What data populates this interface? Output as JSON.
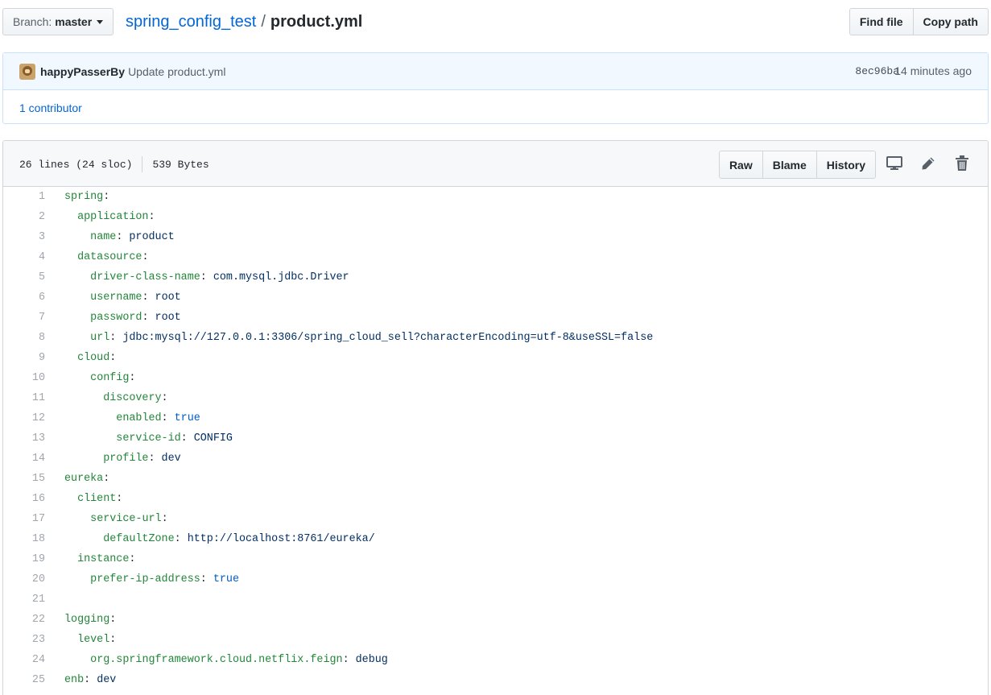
{
  "topbar": {
    "branch_prefix": "Branch:",
    "branch_name": "master",
    "repo": "spring_config_test",
    "sep": "/",
    "file": "product.yml",
    "find_file": "Find file",
    "copy_path": "Copy path"
  },
  "commit": {
    "author": "happyPasserBy",
    "message": "Update product.yml",
    "sha": "8ec96ba",
    "time": "14 minutes ago",
    "contributors": "1 contributor"
  },
  "file": {
    "lines_info": "26 lines (24 sloc)",
    "size": "539 Bytes",
    "raw": "Raw",
    "blame": "Blame",
    "history": "History",
    "icons": [
      "desktop-icon",
      "pencil-icon",
      "trash-icon"
    ]
  },
  "code": [
    {
      "n": "1",
      "indent": "",
      "key": "spring",
      "value": "",
      "vtype": ""
    },
    {
      "n": "2",
      "indent": "  ",
      "key": "application",
      "value": "",
      "vtype": ""
    },
    {
      "n": "3",
      "indent": "    ",
      "key": "name",
      "value": "product",
      "vtype": "str"
    },
    {
      "n": "4",
      "indent": "  ",
      "key": "datasource",
      "value": "",
      "vtype": ""
    },
    {
      "n": "5",
      "indent": "    ",
      "key": "driver-class-name",
      "value": "com.mysql.jdbc.Driver",
      "vtype": "str"
    },
    {
      "n": "6",
      "indent": "    ",
      "key": "username",
      "value": "root",
      "vtype": "str"
    },
    {
      "n": "7",
      "indent": "    ",
      "key": "password",
      "value": "root",
      "vtype": "str"
    },
    {
      "n": "8",
      "indent": "    ",
      "key": "url",
      "value": "jdbc:mysql://127.0.0.1:3306/spring_cloud_sell?characterEncoding=utf-8&useSSL=false",
      "vtype": "str"
    },
    {
      "n": "9",
      "indent": "  ",
      "key": "cloud",
      "value": "",
      "vtype": ""
    },
    {
      "n": "10",
      "indent": "    ",
      "key": "config",
      "value": "",
      "vtype": ""
    },
    {
      "n": "11",
      "indent": "      ",
      "key": "discovery",
      "value": "",
      "vtype": ""
    },
    {
      "n": "12",
      "indent": "        ",
      "key": "enabled",
      "value": "true",
      "vtype": "bool"
    },
    {
      "n": "13",
      "indent": "        ",
      "key": "service-id",
      "value": "CONFIG",
      "vtype": "str"
    },
    {
      "n": "14",
      "indent": "      ",
      "key": "profile",
      "value": "dev",
      "vtype": "str"
    },
    {
      "n": "15",
      "indent": "",
      "key": "eureka",
      "value": "",
      "vtype": ""
    },
    {
      "n": "16",
      "indent": "  ",
      "key": "client",
      "value": "",
      "vtype": ""
    },
    {
      "n": "17",
      "indent": "    ",
      "key": "service-url",
      "value": "",
      "vtype": ""
    },
    {
      "n": "18",
      "indent": "      ",
      "key": "defaultZone",
      "value": "http://localhost:8761/eureka/",
      "vtype": "str"
    },
    {
      "n": "19",
      "indent": "  ",
      "key": "instance",
      "value": "",
      "vtype": ""
    },
    {
      "n": "20",
      "indent": "    ",
      "key": "prefer-ip-address",
      "value": "true",
      "vtype": "bool"
    },
    {
      "n": "21",
      "indent": "",
      "key": "",
      "value": "",
      "vtype": ""
    },
    {
      "n": "22",
      "indent": "",
      "key": "logging",
      "value": "",
      "vtype": ""
    },
    {
      "n": "23",
      "indent": "  ",
      "key": "level",
      "value": "",
      "vtype": ""
    },
    {
      "n": "24",
      "indent": "    ",
      "key": "org.springframework.cloud.netflix.feign",
      "value": "debug",
      "vtype": "str"
    },
    {
      "n": "25",
      "indent": "",
      "key": "enb",
      "value": "dev",
      "vtype": "str"
    }
  ]
}
